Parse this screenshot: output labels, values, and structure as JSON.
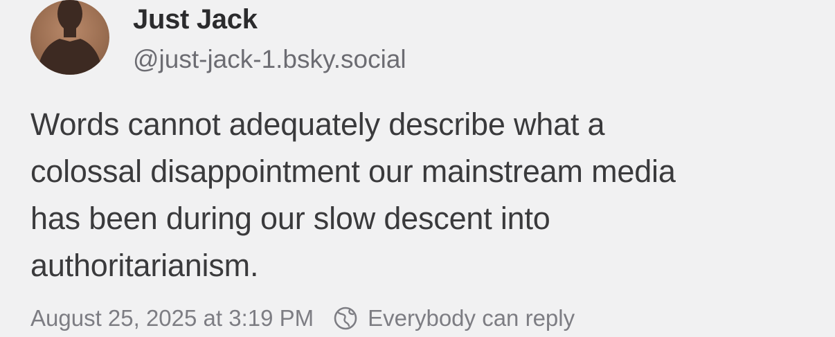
{
  "post": {
    "author": {
      "display_name": "Just Jack",
      "handle": "@just-jack-1.bsky.social"
    },
    "text": "Words cannot adequately describe what a\ncolossal disappointment our mainstream media\nhas been during our slow descent into\nauthoritarianism.",
    "timestamp": "August 25, 2025 at 3:19 PM",
    "reply_setting": "Everybody can reply"
  },
  "icons": {
    "avatar": "person-silhouette",
    "reply_setting": "earth-icon"
  },
  "colors": {
    "background": "#f1f1f2",
    "text": "#3a3a3c",
    "secondary": "#7d7d83"
  }
}
